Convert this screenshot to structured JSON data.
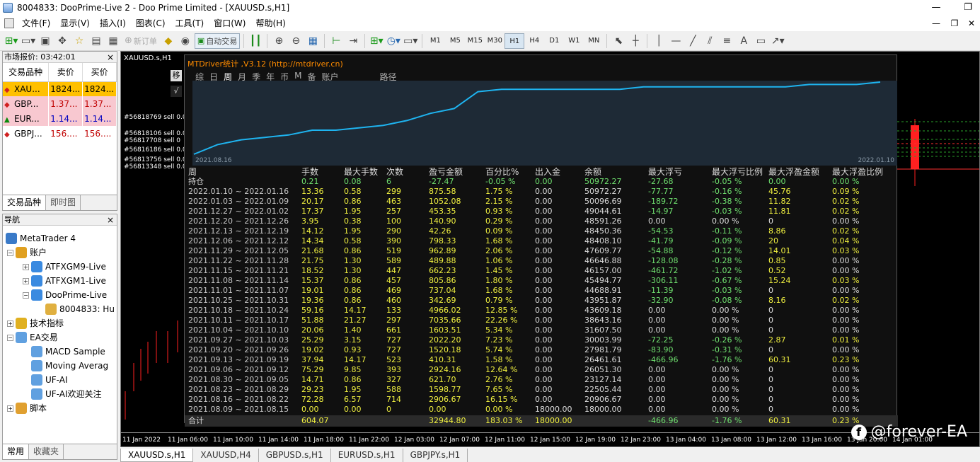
{
  "window": {
    "title": "8004833: DooPrime-Live 2 - Doo Prime Limited - [XAUUSD.s,H1]"
  },
  "menu": [
    "文件(F)",
    "显示(V)",
    "插入(I)",
    "图表(C)",
    "工具(T)",
    "窗口(W)",
    "帮助(H)"
  ],
  "toolbar": {
    "new_order": "新订单",
    "auto_trade": "自动交易",
    "timeframes": [
      "M1",
      "M5",
      "M15",
      "M30",
      "H1",
      "H4",
      "D1",
      "W1",
      "MN"
    ],
    "active_timeframe": "H1"
  },
  "market_watch": {
    "title": "市场报价: 03:42:01",
    "columns": [
      "交易品种",
      "卖价",
      "买价"
    ],
    "rows": [
      {
        "symbol": "XAU...",
        "bid": "1824...",
        "ask": "1824...",
        "dir": "down",
        "bg": "#ffc000",
        "color": "#000000"
      },
      {
        "symbol": "GBP...",
        "bid": "1.37...",
        "ask": "1.37...",
        "dir": "down",
        "bg": "#f8c8d0",
        "color": "#c00000"
      },
      {
        "symbol": "EUR...",
        "bid": "1.14...",
        "ask": "1.14...",
        "dir": "up",
        "bg": "#f8c8d0",
        "color": "#0000c0"
      },
      {
        "symbol": "GBPJ...",
        "bid": "156....",
        "ask": "156....",
        "dir": "down",
        "bg": "#ffffff",
        "color": "#c00000"
      }
    ],
    "tabs": [
      "交易品种",
      "即时图"
    ]
  },
  "navigator": {
    "title": "导航",
    "items": [
      {
        "label": "MetaTrader 4",
        "level": 0,
        "exp": "",
        "icon": "mt4-icon"
      },
      {
        "label": "账户",
        "level": 1,
        "exp": "−",
        "icon": "accounts-icon"
      },
      {
        "label": "ATFXGM9-Live",
        "level": 2,
        "exp": "+",
        "icon": "server-icon"
      },
      {
        "label": "ATFXGM1-Live",
        "level": 2,
        "exp": "+",
        "icon": "server-icon"
      },
      {
        "label": "DooPrime-Live",
        "level": 2,
        "exp": "−",
        "icon": "server-icon"
      },
      {
        "label": "8004833: Hu",
        "level": 3,
        "exp": "",
        "icon": "user-icon"
      },
      {
        "label": "技术指标",
        "level": 1,
        "exp": "+",
        "icon": "indicator-icon"
      },
      {
        "label": "EA交易",
        "level": 1,
        "exp": "−",
        "icon": "ea-icon"
      },
      {
        "label": "MACD Sample",
        "level": 2,
        "exp": "",
        "icon": "ea-icon"
      },
      {
        "label": "Moving Averag",
        "level": 2,
        "exp": "",
        "icon": "ea-icon"
      },
      {
        "label": "UF-AI",
        "level": 2,
        "exp": "",
        "icon": "ea-icon"
      },
      {
        "label": "UF-AI欢迎关注",
        "level": 2,
        "exp": "",
        "icon": "ea-icon"
      },
      {
        "label": "脚本",
        "level": 1,
        "exp": "+",
        "icon": "script-icon"
      }
    ],
    "tabs": [
      "常用",
      "收藏夹"
    ]
  },
  "chart": {
    "label": "XAUUSD.s,H1",
    "sell_lines": [
      "#56818769 sell 0.0",
      "#56818106 sell 0.0",
      "#56817708 sell 0",
      "#56816186 sell 0.0",
      "#56813756 sell 0.0",
      "#56813348 sell 0.0"
    ],
    "side_buttons": [
      "移",
      "√"
    ],
    "time_labels": [
      "11 Jan 2022",
      "11 Jan 06:00",
      "11 Jan 10:00",
      "11 Jan 14:00",
      "11 Jan 18:00",
      "11 Jan 22:00",
      "12 Jan 03:00",
      "12 Jan 07:00",
      "12 Jan 11:00",
      "12 Jan 15:00",
      "12 Jan 19:00",
      "12 Jan 23:00",
      "13 Jan 04:00",
      "13 Jan 08:00",
      "13 Jan 12:00",
      "13 Jan 16:00",
      "13 Jan 20:00",
      "14 Jan 01:00"
    ]
  },
  "mtdriver": {
    "title": "MTDriver统计 ,V3.12 (http://mtdriver.cn)",
    "tabs": [
      "综",
      "日",
      "周",
      "月",
      "季",
      "年",
      "币",
      "M",
      "备",
      "账户",
      "路径"
    ],
    "active_tab": "周",
    "equity_start": "2021.08.16",
    "equity_end": "2022.01.10",
    "equity_curve": [
      0,
      4,
      6,
      7,
      8,
      10,
      10,
      11,
      12,
      14,
      17,
      19,
      26,
      27,
      27,
      27,
      27,
      27,
      27,
      28,
      28,
      28,
      28,
      28,
      28,
      28,
      29,
      29,
      29,
      30
    ],
    "columns": [
      "周",
      "手数",
      "最大手数",
      "次数",
      "盈亏金额",
      "百分比%",
      "出入金",
      "余额",
      "最大浮亏",
      "最大浮亏比例",
      "最大浮盈金额",
      "最大浮盈比例"
    ],
    "holding": [
      "持仓",
      "0.21",
      "0.08",
      "6",
      "-27.47",
      "-0.05 %",
      "0.00",
      "50972.27",
      "-27.68",
      "-0.05 %",
      "0.00",
      "0.00 %"
    ],
    "rows": [
      [
        "2022.01.10 ~ 2022.01.16",
        "13.36",
        "0.58",
        "299",
        "875.58",
        "1.75 %",
        "0.00",
        "50972.27",
        "-77.77",
        "-0.16 %",
        "45.76",
        "0.09 %"
      ],
      [
        "2022.01.03 ~ 2022.01.09",
        "20.17",
        "0.86",
        "463",
        "1052.08",
        "2.15 %",
        "0.00",
        "50096.69",
        "-189.72",
        "-0.38 %",
        "11.82",
        "0.02 %"
      ],
      [
        "2021.12.27 ~ 2022.01.02",
        "17.37",
        "1.95",
        "257",
        "453.35",
        "0.93 %",
        "0.00",
        "49044.61",
        "-14.97",
        "-0.03 %",
        "11.81",
        "0.02 %"
      ],
      [
        "2021.12.20 ~ 2021.12.26",
        "3.95",
        "0.38",
        "100",
        "140.90",
        "0.29 %",
        "0.00",
        "48591.26",
        "0.00",
        "0.00 %",
        "0",
        "0.00 %"
      ],
      [
        "2021.12.13 ~ 2021.12.19",
        "14.12",
        "1.95",
        "290",
        "42.26",
        "0.09 %",
        "0.00",
        "48450.36",
        "-54.53",
        "-0.11 %",
        "8.86",
        "0.02 %"
      ],
      [
        "2021.12.06 ~ 2021.12.12",
        "14.34",
        "0.58",
        "390",
        "798.33",
        "1.68 %",
        "0.00",
        "48408.10",
        "-41.79",
        "-0.09 %",
        "20",
        "0.04 %"
      ],
      [
        "2021.11.29 ~ 2021.12.05",
        "21.68",
        "0.86",
        "519",
        "962.89",
        "2.06 %",
        "0.00",
        "47609.77",
        "-54.88",
        "-0.12 %",
        "14.01",
        "0.03 %"
      ],
      [
        "2021.11.22 ~ 2021.11.28",
        "21.75",
        "1.30",
        "589",
        "489.88",
        "1.06 %",
        "0.00",
        "46646.88",
        "-128.08",
        "-0.28 %",
        "0.85",
        "0.00 %"
      ],
      [
        "2021.11.15 ~ 2021.11.21",
        "18.52",
        "1.30",
        "447",
        "662.23",
        "1.45 %",
        "0.00",
        "46157.00",
        "-461.72",
        "-1.02 %",
        "0.52",
        "0.00 %"
      ],
      [
        "2021.11.08 ~ 2021.11.14",
        "15.37",
        "0.86",
        "457",
        "805.86",
        "1.80 %",
        "0.00",
        "45494.77",
        "-306.11",
        "-0.67 %",
        "15.24",
        "0.03 %"
      ],
      [
        "2021.11.01 ~ 2021.11.07",
        "19.01",
        "0.86",
        "469",
        "737.04",
        "1.68 %",
        "0.00",
        "44688.91",
        "-11.39",
        "-0.03 %",
        "0",
        "0.00 %"
      ],
      [
        "2021.10.25 ~ 2021.10.31",
        "19.36",
        "0.86",
        "460",
        "342.69",
        "0.79 %",
        "0.00",
        "43951.87",
        "-32.90",
        "-0.08 %",
        "8.16",
        "0.02 %"
      ],
      [
        "2021.10.18 ~ 2021.10.24",
        "59.16",
        "14.17",
        "133",
        "4966.02",
        "12.85 %",
        "0.00",
        "43609.18",
        "0.00",
        "0.00 %",
        "0",
        "0.00 %"
      ],
      [
        "2021.10.11 ~ 2021.10.17",
        "51.88",
        "21.27",
        "297",
        "7035.66",
        "22.26 %",
        "0.00",
        "38643.16",
        "0.00",
        "0.00 %",
        "0",
        "0.00 %"
      ],
      [
        "2021.10.04 ~ 2021.10.10",
        "20.06",
        "1.40",
        "661",
        "1603.51",
        "5.34 %",
        "0.00",
        "31607.50",
        "0.00",
        "0.00 %",
        "0",
        "0.00 %"
      ],
      [
        "2021.09.27 ~ 2021.10.03",
        "25.29",
        "3.15",
        "727",
        "2022.20",
        "7.23 %",
        "0.00",
        "30003.99",
        "-72.25",
        "-0.26 %",
        "2.87",
        "0.01 %"
      ],
      [
        "2021.09.20 ~ 2021.09.26",
        "19.02",
        "0.93",
        "727",
        "1520.18",
        "5.74 %",
        "0.00",
        "27981.79",
        "-83.90",
        "-0.31 %",
        "0",
        "0.00 %"
      ],
      [
        "2021.09.13 ~ 2021.09.19",
        "37.94",
        "14.17",
        "523",
        "410.31",
        "1.58 %",
        "0.00",
        "26461.61",
        "-466.96",
        "-1.76 %",
        "60.31",
        "0.23 %"
      ],
      [
        "2021.09.06 ~ 2021.09.12",
        "75.29",
        "9.85",
        "393",
        "2924.16",
        "12.64 %",
        "0.00",
        "26051.30",
        "0.00",
        "0.00 %",
        "0",
        "0.00 %"
      ],
      [
        "2021.08.30 ~ 2021.09.05",
        "14.71",
        "0.86",
        "327",
        "621.70",
        "2.76 %",
        "0.00",
        "23127.14",
        "0.00",
        "0.00 %",
        "0",
        "0.00 %"
      ],
      [
        "2021.08.23 ~ 2021.08.29",
        "29.23",
        "1.95",
        "588",
        "1598.77",
        "7.65 %",
        "0.00",
        "22505.44",
        "0.00",
        "0.00 %",
        "0",
        "0.00 %"
      ],
      [
        "2021.08.16 ~ 2021.08.22",
        "72.28",
        "6.57",
        "714",
        "2906.67",
        "16.15 %",
        "0.00",
        "20906.67",
        "0.00",
        "0.00 %",
        "0",
        "0.00 %"
      ],
      [
        "2021.08.09 ~ 2021.08.15",
        "0.00",
        "0.00",
        "0",
        "0.00",
        "0.00 %",
        "18000.00",
        "18000.00",
        "0.00",
        "0.00 %",
        "0",
        "0.00 %"
      ]
    ],
    "total": [
      "合计",
      "604.07",
      "",
      "",
      "32944.80",
      "183.03 %",
      "18000.00",
      "",
      "-466.96",
      "-1.76 %",
      "60.31",
      "0.23 %"
    ]
  },
  "bottom_tabs": [
    "XAUUSD.s,H1",
    "XAUUSD,H4",
    "GBPUSD.s,H1",
    "EURUSD.s,H1",
    "GBPJPY.s,H1"
  ],
  "watermark": "@forever-EA"
}
